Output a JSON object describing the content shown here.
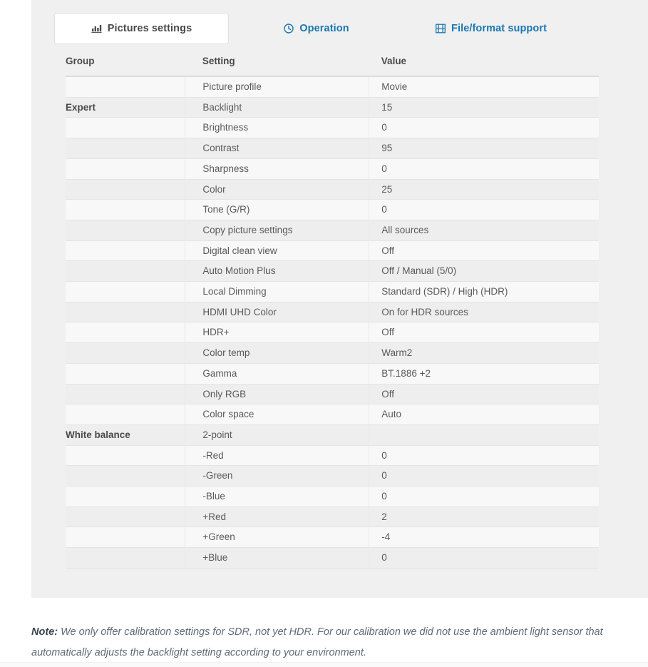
{
  "tabs": [
    {
      "label": "Pictures settings",
      "icon": "bar-chart-icon",
      "active": true,
      "color": "#4a4a4a"
    },
    {
      "label": "Operation",
      "icon": "clock-icon",
      "active": false,
      "color": "#1b76b0"
    },
    {
      "label": "File/format support",
      "icon": "film-icon",
      "active": false,
      "color": "#1b76b0"
    }
  ],
  "table": {
    "columns": [
      "Group",
      "Setting",
      "Value"
    ],
    "rows": [
      {
        "group": "",
        "setting": "Picture profile",
        "value": "Movie"
      },
      {
        "group": "Expert",
        "setting": "Backlight",
        "value": "15"
      },
      {
        "group": "",
        "setting": "Brightness",
        "value": "0"
      },
      {
        "group": "",
        "setting": "Contrast",
        "value": "95"
      },
      {
        "group": "",
        "setting": "Sharpness",
        "value": "0"
      },
      {
        "group": "",
        "setting": "Color",
        "value": "25"
      },
      {
        "group": "",
        "setting": "Tone (G/R)",
        "value": "0"
      },
      {
        "group": "",
        "setting": "Copy picture settings",
        "value": "All sources"
      },
      {
        "group": "",
        "setting": "Digital clean view",
        "value": "Off"
      },
      {
        "group": "",
        "setting": "Auto Motion Plus",
        "value": "Off / Manual (5/0)"
      },
      {
        "group": "",
        "setting": "Local Dimming",
        "value": "Standard (SDR) / High (HDR)"
      },
      {
        "group": "",
        "setting": "HDMI UHD Color",
        "value": "On for HDR sources"
      },
      {
        "group": "",
        "setting": "HDR+",
        "value": "Off"
      },
      {
        "group": "",
        "setting": "Color temp",
        "value": "Warm2"
      },
      {
        "group": "",
        "setting": "Gamma",
        "value": "BT.1886 +2"
      },
      {
        "group": "",
        "setting": "Only RGB",
        "value": "Off"
      },
      {
        "group": "",
        "setting": "Color space",
        "value": "Auto"
      },
      {
        "group": "White balance",
        "setting": "2-point",
        "value": ""
      },
      {
        "group": "",
        "setting": "-Red",
        "value": "0"
      },
      {
        "group": "",
        "setting": "-Green",
        "value": "0"
      },
      {
        "group": "",
        "setting": "-Blue",
        "value": "0"
      },
      {
        "group": "",
        "setting": "+Red",
        "value": "2"
      },
      {
        "group": "",
        "setting": "+Green",
        "value": "-4"
      },
      {
        "group": "",
        "setting": "+Blue",
        "value": "0"
      }
    ]
  },
  "note": {
    "label": "Note:",
    "text": "We only offer calibration settings for SDR, not yet HDR. For our calibration we did not use the ambient light sensor that automatically adjusts the backlight setting according to your environment."
  }
}
